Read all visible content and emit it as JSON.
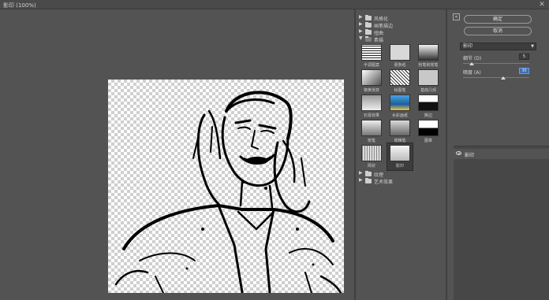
{
  "window": {
    "title": "影印 (100%)",
    "close_glyph": "✕"
  },
  "gallery": {
    "folders_top": [
      {
        "label": "风格化",
        "state": "collapsed"
      },
      {
        "label": "画笔描边",
        "state": "collapsed"
      },
      {
        "label": "扭曲",
        "state": "collapsed"
      },
      {
        "label": "素描",
        "state": "expanded"
      }
    ],
    "thumbnails": [
      {
        "label": "半调图案"
      },
      {
        "label": "便条纸"
      },
      {
        "label": "粉笔和炭笔"
      },
      {
        "label": "铬黄渐变"
      },
      {
        "label": "绘图笔"
      },
      {
        "label": "基底凸现"
      },
      {
        "label": "石膏效果"
      },
      {
        "label": "水彩画纸"
      },
      {
        "label": "撕边"
      },
      {
        "label": "炭笔"
      },
      {
        "label": "炭精笔"
      },
      {
        "label": "图章"
      },
      {
        "label": "网状"
      },
      {
        "label": "影印",
        "selected": true
      }
    ],
    "folders_bottom": [
      {
        "label": "纹理",
        "state": "collapsed"
      },
      {
        "label": "艺术效果",
        "state": "collapsed"
      }
    ]
  },
  "settings": {
    "collapse_glyph": "«",
    "ok_label": "确定",
    "cancel_label": "取消",
    "filter_select": "影印",
    "params": [
      {
        "label": "细节 (D)",
        "value": "5",
        "slider_fraction": 0.2
      },
      {
        "label": "暗度 (A)",
        "value": "30",
        "slider_fraction": 0.6
      }
    ]
  },
  "layers": {
    "items": [
      {
        "name": "影印",
        "visible": true
      }
    ]
  },
  "colors": {
    "panel_bg": "#535353",
    "selection_blue": "#3a6fb5"
  }
}
